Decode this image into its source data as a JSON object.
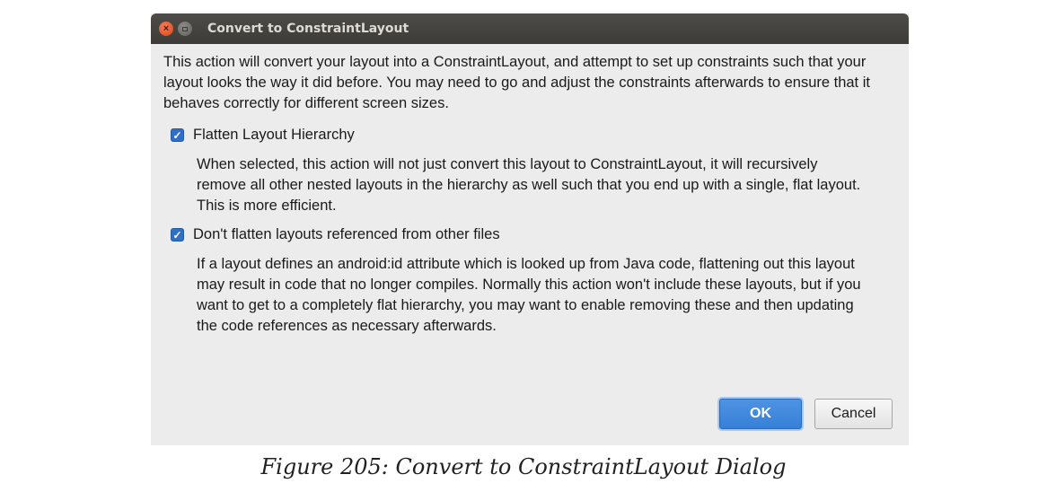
{
  "window": {
    "title": "Convert to ConstraintLayout",
    "close_symbol": "×"
  },
  "content": {
    "intro": "This action will convert your layout into a ConstraintLayout, and attempt to set up constraints such that your layout looks the way it did before. You may need to go and adjust the constraints afterwards to ensure that it behaves correctly for different screen sizes."
  },
  "options": [
    {
      "label": "Flatten Layout Hierarchy",
      "checked": true,
      "description": "When selected, this action will not just convert this layout to ConstraintLayout, it will recursively remove all other nested layouts in the hierarchy as well such that you end up with a single, flat layout. This is more efficient."
    },
    {
      "label": "Don't flatten layouts referenced from other files",
      "checked": true,
      "description": "If a layout defines an android:id attribute which is looked up from Java code, flattening out this layout may result in code that no longer compiles. Normally this action won't include these layouts, but if you want to get to a completely flat hierarchy, you may want to enable removing these and then updating the code references as necessary afterwards."
    }
  ],
  "buttons": {
    "ok": "OK",
    "cancel": "Cancel"
  },
  "check_mark": "✓",
  "caption": "Figure 205: Convert to ConstraintLayout Dialog",
  "colors": {
    "titlebar": "#3c3b37",
    "dialog_bg": "#ececec",
    "accent": "#3580d8",
    "close_button": "#e2542a"
  },
  "icons": [
    "close-icon",
    "minimize-icon",
    "check-icon"
  ]
}
